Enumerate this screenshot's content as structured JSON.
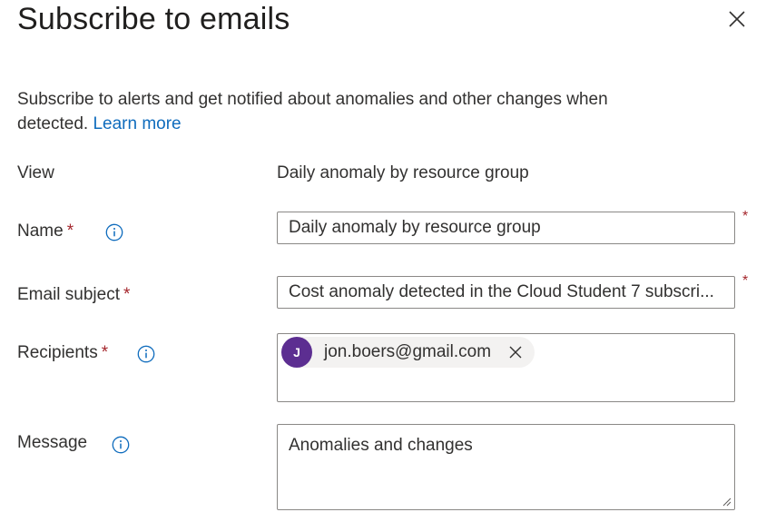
{
  "panel": {
    "title": "Subscribe to emails",
    "description": "Subscribe to alerts and get notified about anomalies and other changes when detected.",
    "learn_more": "Learn more",
    "close_icon": "close-icon"
  },
  "form": {
    "view": {
      "label": "View",
      "value": "Daily anomaly by resource group"
    },
    "name": {
      "label": "Name",
      "required_mark": "*",
      "value": "Daily anomaly by resource group",
      "info_icon": "info-icon"
    },
    "email_subject": {
      "label": "Email subject",
      "required_mark": "*",
      "value": "Cost anomaly detected in the Cloud Student 7 subscri..."
    },
    "recipients": {
      "label": "Recipients",
      "required_mark": "*",
      "info_icon": "info-icon",
      "items": [
        {
          "initial": "J",
          "email": "jon.boers@gmail.com",
          "avatar_color": "#5c2e91"
        }
      ]
    },
    "message": {
      "label": "Message",
      "value": "Anomalies and changes",
      "info_icon": "info-icon"
    }
  },
  "colors": {
    "link": "#0f6cbd",
    "required": "#a4262c",
    "avatar": "#5c2e91",
    "border": "#8a8886"
  }
}
